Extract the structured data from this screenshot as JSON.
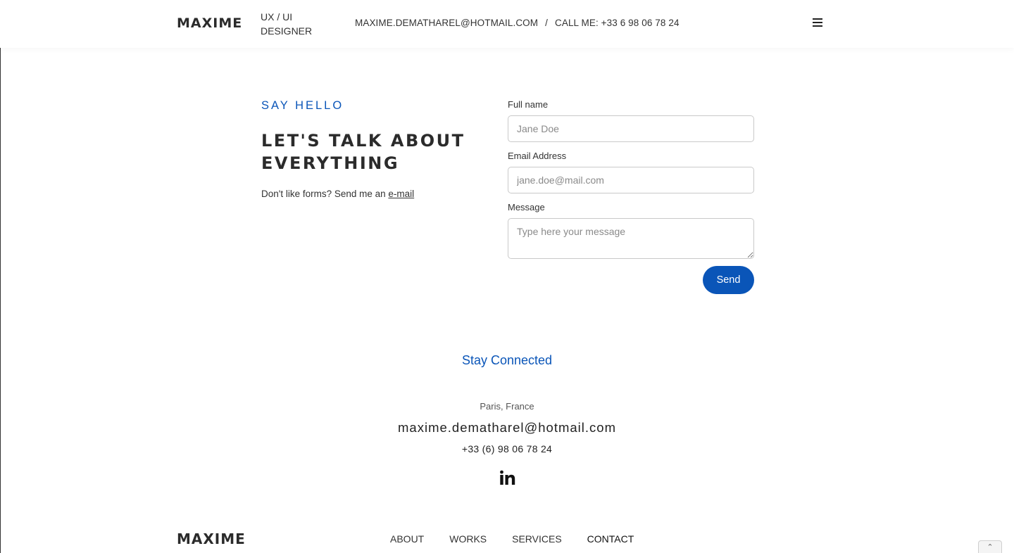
{
  "header": {
    "logo": "MAXIME",
    "role": "UX / UI DESIGNER",
    "email": "MAXIME.DEMATHAREL@HOTMAIL.COM",
    "separator": "/",
    "call": "CALL ME: +33 6 98 06 78 24",
    "menu_icon": "hamburger-menu-icon"
  },
  "intro": {
    "eyebrow": "SAY HELLO",
    "headline": "LET'S TALK ABOUT EVERYTHING",
    "forms_note": "Don't like forms? Send me an ",
    "forms_link": "e-mail"
  },
  "form": {
    "name_label": "Full name",
    "name_placeholder": "Jane Doe",
    "email_label": "Email Address",
    "email_placeholder": "jane.doe@mail.com",
    "message_label": "Message",
    "message_placeholder": "Type here your message",
    "send_label": "Send"
  },
  "connect": {
    "title": "Stay Connected",
    "city": "Paris, France",
    "email": "maxime.dematharel@hotmail.com",
    "phone": "+33 (6) 98 06 78 24",
    "social_icon": "linkedin-icon"
  },
  "footer": {
    "logo": "MAXIME",
    "nav": [
      "ABOUT",
      "WORKS",
      "SERVICES",
      "CONTACT"
    ],
    "active": "CONTACT",
    "scroll_icon": "chevron-up-icon"
  },
  "colors": {
    "accent": "#0a55b8",
    "text": "#333333"
  }
}
